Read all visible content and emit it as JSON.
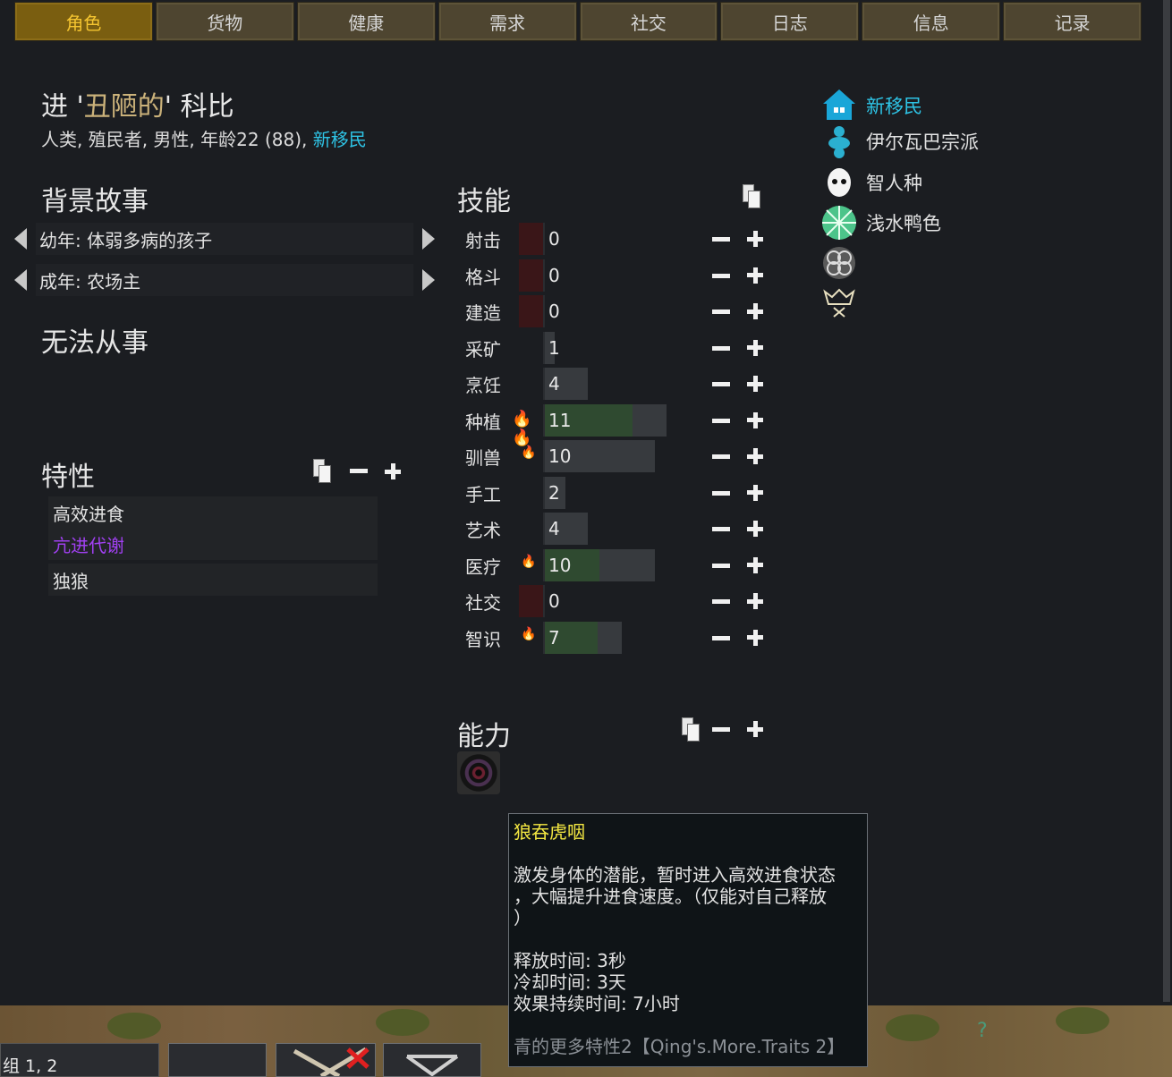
{
  "tabs": [
    "角色",
    "货物",
    "健康",
    "需求",
    "社交",
    "日志",
    "信息",
    "记录"
  ],
  "pawn": {
    "first": "进 '",
    "nick": "丑陋的",
    "last": "' 科比",
    "desc_main": "人类, 殖民者, 男性, 年龄22 (88), ",
    "desc_faction": "新移民"
  },
  "backstory": {
    "title": "背景故事",
    "childhood": "幼年: 体弱多病的孩子",
    "adulthood": "成年: 农场主"
  },
  "incapable": {
    "title": "无法从事"
  },
  "traits": {
    "title": "特性",
    "items": [
      {
        "label": "高效进食"
      },
      {
        "label": "亢进代谢"
      },
      {
        "label": "独狼"
      }
    ]
  },
  "skills": {
    "title": "技能",
    "max_level": 20,
    "items": [
      {
        "name": "射击",
        "level": "0",
        "passion": 0,
        "progress": 0
      },
      {
        "name": "格斗",
        "level": "0",
        "passion": 0,
        "progress": 0
      },
      {
        "name": "建造",
        "level": "0",
        "passion": 0,
        "progress": 0
      },
      {
        "name": "采矿",
        "level": "1",
        "passion": 0,
        "progress": 0
      },
      {
        "name": "烹饪",
        "level": "4",
        "passion": 0,
        "progress": 0
      },
      {
        "name": "种植",
        "level": "11",
        "passion": 2,
        "progress": 0.73
      },
      {
        "name": "驯兽",
        "level": "10",
        "passion": 1,
        "progress": 0
      },
      {
        "name": "手工",
        "level": "2",
        "passion": 0,
        "progress": 0
      },
      {
        "name": "艺术",
        "level": "4",
        "passion": 0,
        "progress": 0
      },
      {
        "name": "医疗",
        "level": "10",
        "passion": 1,
        "progress": 0.5
      },
      {
        "name": "社交",
        "level": "0",
        "passion": 0,
        "progress": 0
      },
      {
        "name": "智识",
        "level": "7",
        "passion": 1,
        "progress": 0.7
      }
    ]
  },
  "meta": {
    "faction": "新移民",
    "ideology": "伊尔瓦巴宗派",
    "xenotype": "智人种",
    "skin": "浅水鸭色"
  },
  "abilities": {
    "title": "能力"
  },
  "tooltip": {
    "title": "狼吞虎咽",
    "body_line1": "激发身体的潜能，暂时进入高效进食状态",
    "body_line2": "，大幅提升进食速度。（仅能对自己释放",
    "body_line3": "）",
    "cast_time": "释放时间: 3秒",
    "cooldown": "冷却时间: 3天",
    "duration": "效果持续时间: 7小时",
    "source": "青的更多特性2【Qing's.More.Traits 2】"
  },
  "hud": {
    "group_label": "组 1, 2"
  },
  "colors": {
    "accent_tab": "#7a5e10",
    "faction_cyan": "#2ec4e6",
    "trait_purple": "#a040f0",
    "tooltip_title": "#f4e842"
  }
}
